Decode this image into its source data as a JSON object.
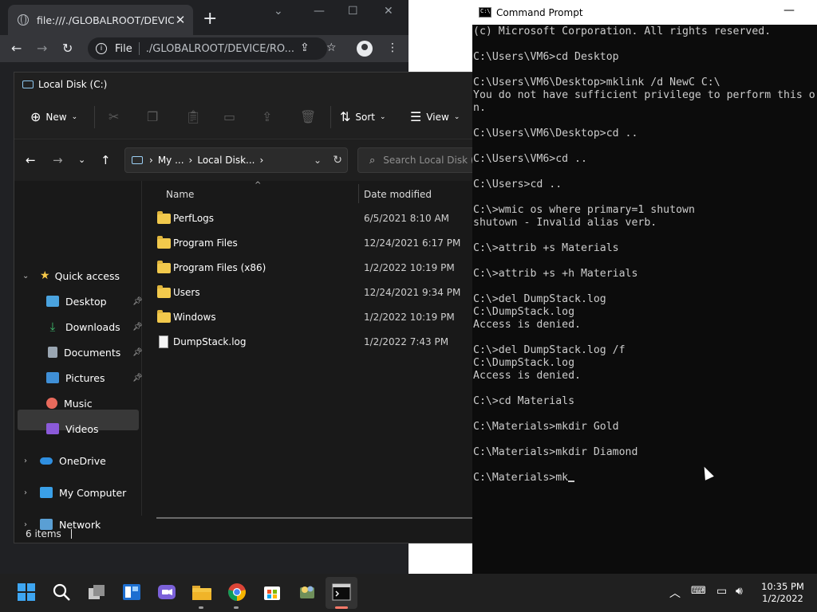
{
  "chrome": {
    "tab_title": "file:///./GLOBALROOT/DEVICE/R",
    "tab_close": "✕",
    "new_tab": "+",
    "omnibox_scheme": "File",
    "omnibox_url": "./GLOBALROOT/DEVICE/RO..."
  },
  "explorer": {
    "title": "Local Disk (C:)",
    "cmd_new": "New",
    "cmd_sort": "Sort",
    "cmd_view": "View",
    "crumb_1": "My ...",
    "crumb_2": "Local Disk...",
    "search_placeholder": "Search Local Disk (C:)",
    "nav": {
      "quick_access": "Quick access",
      "desktop": "Desktop",
      "downloads": "Downloads",
      "documents": "Documents",
      "pictures": "Pictures",
      "music": "Music",
      "videos": "Videos",
      "onedrive": "OneDrive",
      "my_computer": "My Computer",
      "network": "Network"
    },
    "columns": {
      "name": "Name",
      "date": "Date modified"
    },
    "files": [
      {
        "name": "PerfLogs",
        "date": "6/5/2021 8:10 AM",
        "type": "folder"
      },
      {
        "name": "Program Files",
        "date": "12/24/2021 6:17 PM",
        "type": "folder"
      },
      {
        "name": "Program Files (x86)",
        "date": "1/2/2022 10:19 PM",
        "type": "folder"
      },
      {
        "name": "Users",
        "date": "12/24/2021 9:34 PM",
        "type": "folder"
      },
      {
        "name": "Windows",
        "date": "1/2/2022 10:19 PM",
        "type": "folder"
      },
      {
        "name": "DumpStack.log",
        "date": "1/2/2022 7:43 PM",
        "type": "file"
      }
    ],
    "status": "6 items"
  },
  "cmd": {
    "title": "Command Prompt",
    "lines": [
      "(c) Microsoft Corporation. All rights reserved.",
      "",
      "C:\\Users\\VM6>cd Desktop",
      "",
      "C:\\Users\\VM6\\Desktop>mklink /d NewC C:\\",
      "You do not have sufficient privilege to perform this o",
      "n.",
      "",
      "C:\\Users\\VM6\\Desktop>cd ..",
      "",
      "C:\\Users\\VM6>cd ..",
      "",
      "C:\\Users>cd ..",
      "",
      "C:\\>wmic os where primary=1 shutown",
      "shutown - Invalid alias verb.",
      "",
      "C:\\>attrib +s Materials",
      "",
      "C:\\>attrib +s +h Materials",
      "",
      "C:\\>del DumpStack.log",
      "C:\\DumpStack.log",
      "Access is denied.",
      "",
      "C:\\>del DumpStack.log /f",
      "C:\\DumpStack.log",
      "Access is denied.",
      "",
      "C:\\>cd Materials",
      "",
      "C:\\Materials>mkdir Gold",
      "",
      "C:\\Materials>mkdir Diamond",
      ""
    ],
    "prompt_line": "C:\\Materials>mk"
  },
  "taskbar": {
    "time": "10:35 PM",
    "date": "1/2/2022"
  }
}
